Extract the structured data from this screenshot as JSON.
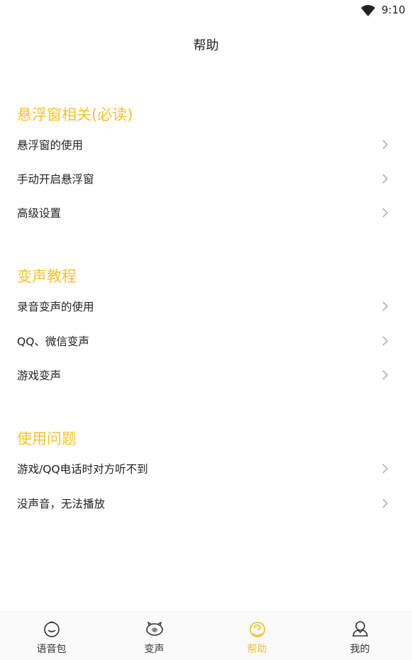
{
  "status_bar": {
    "time": "9:10"
  },
  "header": {
    "title": "帮助"
  },
  "sections": [
    {
      "title": "悬浮窗相关(必读)",
      "items": [
        "悬浮窗的使用",
        "手动开启悬浮窗",
        "高级设置"
      ]
    },
    {
      "title": "变声教程",
      "items": [
        "录音变声的使用",
        "QQ、微信变声",
        "游戏变声"
      ]
    },
    {
      "title": "使用问题",
      "items": [
        "游戏/QQ电话时对方听不到",
        "没声音，无法播放"
      ]
    }
  ],
  "tabs": [
    {
      "label": "语音包",
      "icon": "voice-pack-icon"
    },
    {
      "label": "变声",
      "icon": "voice-change-icon"
    },
    {
      "label": "帮助",
      "icon": "help-icon",
      "active": true
    },
    {
      "label": "我的",
      "icon": "profile-icon"
    }
  ],
  "colors": {
    "accent": "#f6c02f",
    "text": "#222222",
    "chevron": "#b5b5b5"
  }
}
